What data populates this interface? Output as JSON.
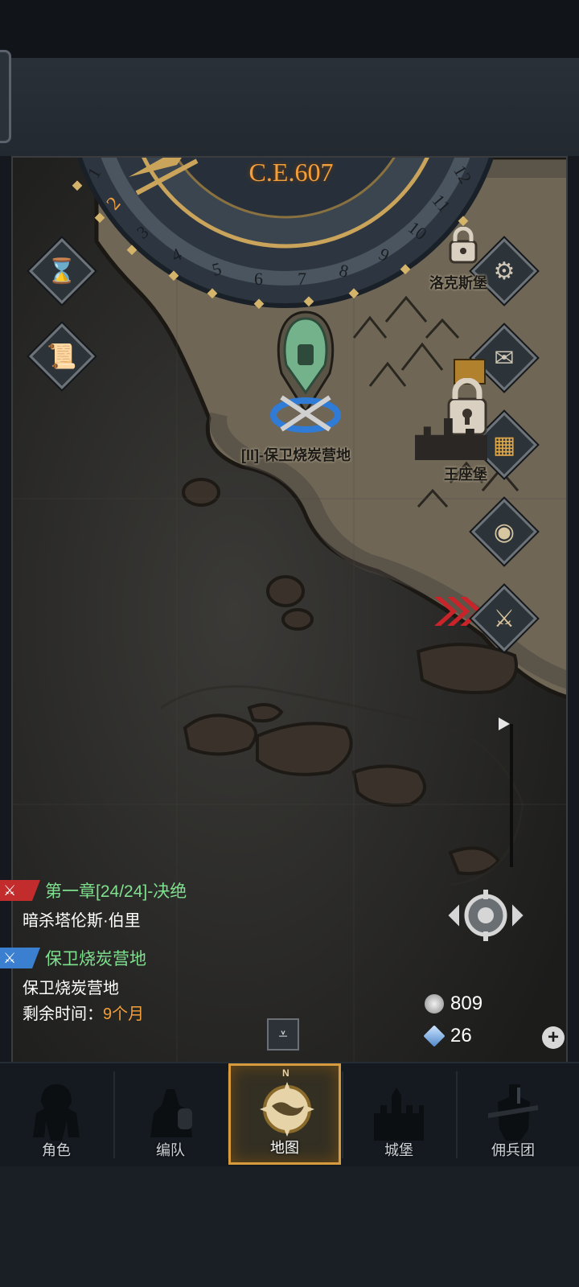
{
  "wheel": {
    "year": "C.E.607",
    "months": [
      "1",
      "2",
      "3",
      "4",
      "5",
      "6",
      "7",
      "8",
      "9",
      "10",
      "11",
      "12"
    ],
    "current_month": "2"
  },
  "map_labels": {
    "mission_marker": "[II]-保卫烧炭营地",
    "castle_1": "洛克斯堡",
    "castle_2": "王座堡"
  },
  "quests": [
    {
      "title": "第一章[24/24]-决绝",
      "detail": "暗杀塔伦斯·伯里",
      "color": "#d93b3b"
    },
    {
      "title": "保卫烧炭营地",
      "detail": "保卫烧炭营地",
      "color": "#4a8fe0"
    }
  ],
  "remaining": {
    "label": "剩余时间：",
    "value": "9个月"
  },
  "resources": {
    "silver": "809",
    "crystal": "26"
  },
  "nav": {
    "tabs": [
      {
        "label": "角色",
        "icon": "knight-icon"
      },
      {
        "label": "编队",
        "icon": "army-icon"
      },
      {
        "label": "地图",
        "icon": "map-compass-icon",
        "active": true
      },
      {
        "label": "城堡",
        "icon": "castle-icon"
      },
      {
        "label": "佣兵团",
        "icon": "mercenary-icon"
      }
    ],
    "compass_n": "N"
  },
  "icons": {
    "left": [
      "hourglass-icon",
      "scroll-icon"
    ],
    "right": [
      "gear-icon",
      "mail-icon",
      "grid-book-icon",
      "coin-icon",
      "warrior-icon"
    ],
    "locate": "crosshair-icon",
    "collapse": "chevron-down-icon",
    "add": "plus-icon"
  }
}
